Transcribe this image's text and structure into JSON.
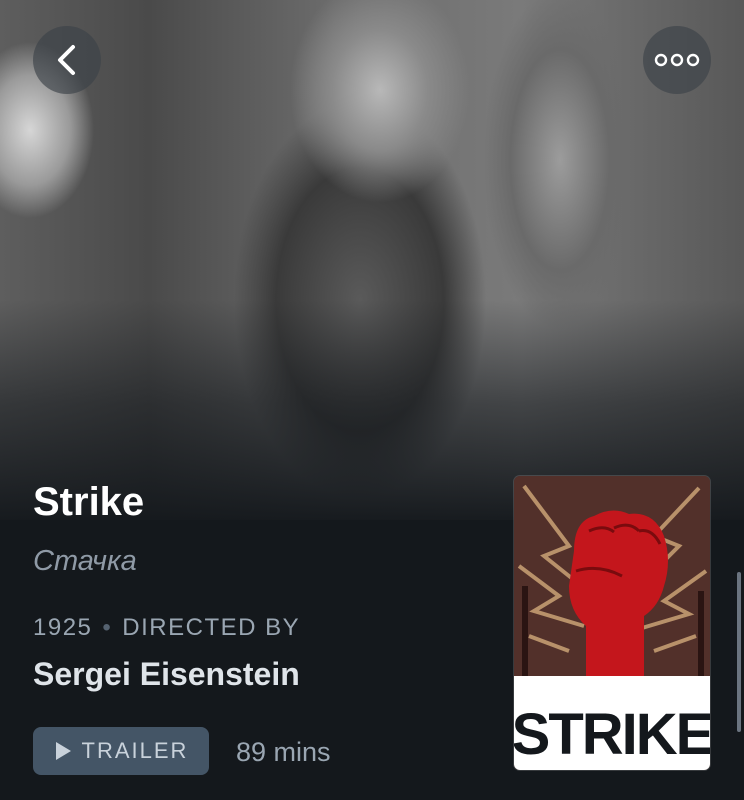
{
  "film": {
    "title": "Strike",
    "original_title": "Стачка",
    "year": "1925",
    "separator": "•",
    "directed_by_label": "DIRECTED BY",
    "director": "Sergei Eisenstein",
    "trailer_label": "TRAILER",
    "runtime": "89 mins"
  },
  "poster": {
    "text": "STRIKE",
    "colors": {
      "background": "#52302a",
      "fist": "#c4161c",
      "lightning": "#b8916a"
    }
  },
  "icons": {
    "back": "chevron-left-icon",
    "more": "more-horizontal-icon",
    "play": "play-icon"
  },
  "colors": {
    "background": "#14181c",
    "title": "#ffffff",
    "muted": "#9aa6b2",
    "button": "#445566"
  }
}
